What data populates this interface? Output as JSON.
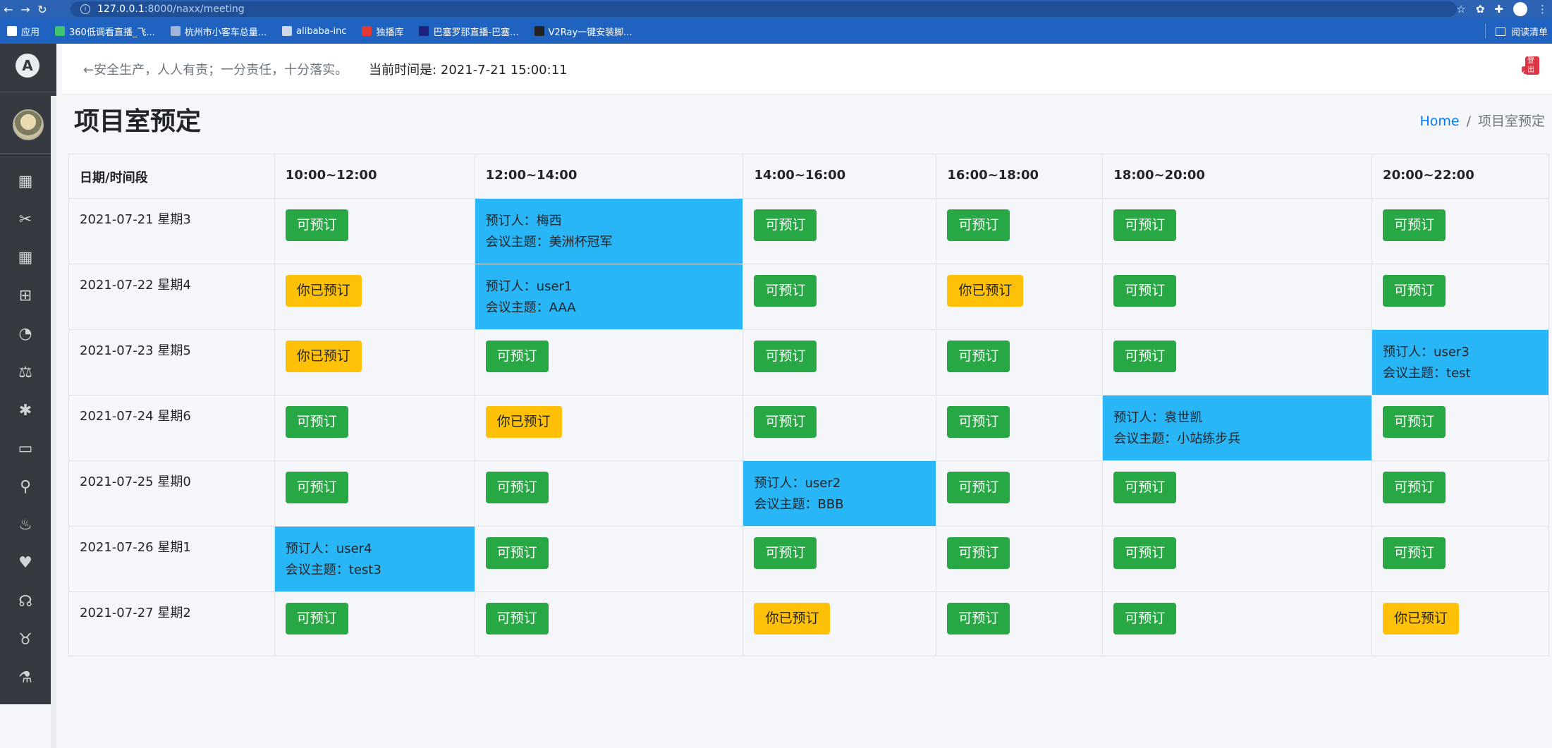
{
  "browser": {
    "url_host": "127.0.0.1",
    "url_rest": ":8000/naxx/meeting",
    "bookmarks": [
      {
        "label": "应用",
        "color": "#ffffff"
      },
      {
        "label": "360低调看直播_飞...",
        "color": "#3ec46d"
      },
      {
        "label": "杭州市小客车总量...",
        "color": "#9fb6d8"
      },
      {
        "label": "alibaba-inc",
        "color": "#cfd8e6"
      },
      {
        "label": "独播库",
        "color": "#e53935"
      },
      {
        "label": "巴塞罗那直播-巴塞...",
        "color": "#1a237e"
      },
      {
        "label": "V2Ray一键安装脚...",
        "color": "#222222"
      }
    ],
    "reading_list": "阅读清单"
  },
  "header": {
    "slogan": "←安全生产，人人有责；一分责任，十分落实。",
    "time_label": "当前时间是: 2021-7-21 15:00:11",
    "logout_badge": "登出"
  },
  "sidebar": {
    "logo": "A",
    "icons": [
      "calendar-icon",
      "scissors-icon",
      "grid-icon",
      "plus-square-icon",
      "dashboard-icon",
      "balance-scale-icon",
      "bug-icon",
      "inbox-icon",
      "binoculars-icon",
      "fire-icon",
      "heartbeat-icon",
      "headphones-icon",
      "piggy-bank-icon",
      "flask-icon"
    ]
  },
  "page": {
    "title": "项目室预定",
    "breadcrumb_home": "Home",
    "breadcrumb_sep": "/",
    "breadcrumb_current": "项目室预定"
  },
  "table": {
    "headers": [
      "日期/时间段",
      "10:00~12:00",
      "12:00~14:00",
      "14:00~16:00",
      "16:00~18:00",
      "18:00~20:00",
      "20:00~22:00"
    ],
    "rows": [
      {
        "date": "2021-07-21 星期3",
        "cells": [
          {
            "type": "free",
            "label": "可预订"
          },
          {
            "type": "booked",
            "booker": "预订人：梅西",
            "topic": "会议主题：美洲杯冠军"
          },
          {
            "type": "free",
            "label": "可预订"
          },
          {
            "type": "free",
            "label": "可预订"
          },
          {
            "type": "free",
            "label": "可预订"
          },
          {
            "type": "free",
            "label": "可预订"
          }
        ]
      },
      {
        "date": "2021-07-22 星期4",
        "cells": [
          {
            "type": "mine",
            "label": "你已预订"
          },
          {
            "type": "booked",
            "booker": "预订人：user1",
            "topic": "会议主题：AAA"
          },
          {
            "type": "free",
            "label": "可预订"
          },
          {
            "type": "mine",
            "label": "你已预订"
          },
          {
            "type": "free",
            "label": "可预订"
          },
          {
            "type": "free",
            "label": "可预订"
          }
        ]
      },
      {
        "date": "2021-07-23 星期5",
        "cells": [
          {
            "type": "mine",
            "label": "你已预订"
          },
          {
            "type": "free",
            "label": "可预订"
          },
          {
            "type": "free",
            "label": "可预订"
          },
          {
            "type": "free",
            "label": "可预订"
          },
          {
            "type": "free",
            "label": "可预订"
          },
          {
            "type": "booked",
            "booker": "预订人：user3",
            "topic": "会议主题：test"
          }
        ]
      },
      {
        "date": "2021-07-24 星期6",
        "cells": [
          {
            "type": "free",
            "label": "可预订"
          },
          {
            "type": "mine",
            "label": "你已预订"
          },
          {
            "type": "free",
            "label": "可预订"
          },
          {
            "type": "free",
            "label": "可预订"
          },
          {
            "type": "booked",
            "booker": "预订人：袁世凯",
            "topic": "会议主题：小站练步兵"
          },
          {
            "type": "free",
            "label": "可预订"
          }
        ]
      },
      {
        "date": "2021-07-25 星期0",
        "cells": [
          {
            "type": "free",
            "label": "可预订"
          },
          {
            "type": "free",
            "label": "可预订"
          },
          {
            "type": "booked",
            "booker": "预订人：user2",
            "topic": "会议主题：BBB"
          },
          {
            "type": "free",
            "label": "可预订"
          },
          {
            "type": "free",
            "label": "可预订"
          },
          {
            "type": "free",
            "label": "可预订"
          }
        ]
      },
      {
        "date": "2021-07-26 星期1",
        "cells": [
          {
            "type": "booked",
            "booker": "预订人：user4",
            "topic": "会议主题：test3"
          },
          {
            "type": "free",
            "label": "可预订"
          },
          {
            "type": "free",
            "label": "可预订"
          },
          {
            "type": "free",
            "label": "可预订"
          },
          {
            "type": "free",
            "label": "可预订"
          },
          {
            "type": "free",
            "label": "可预订"
          }
        ]
      },
      {
        "date": "2021-07-27 星期2",
        "cells": [
          {
            "type": "free",
            "label": "可预订"
          },
          {
            "type": "free",
            "label": "可预订"
          },
          {
            "type": "mine",
            "label": "你已预订"
          },
          {
            "type": "free",
            "label": "可预订"
          },
          {
            "type": "free",
            "label": "可预订"
          },
          {
            "type": "mine",
            "label": "你已预订"
          }
        ]
      }
    ]
  },
  "colors": {
    "free": "#28a745",
    "mine": "#ffc107",
    "booked": "#29b6f6",
    "sidebar": "#343a40"
  }
}
